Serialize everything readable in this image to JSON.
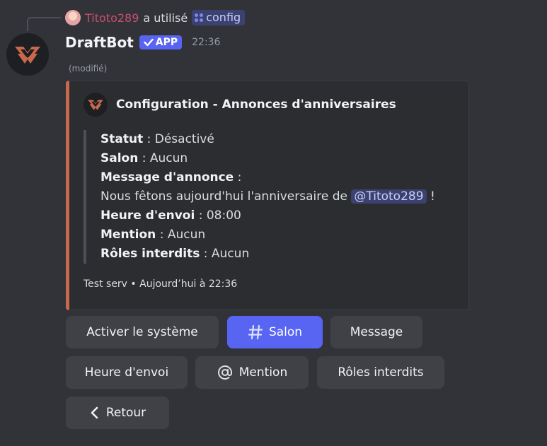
{
  "reply": {
    "username": "Titoto289",
    "action_text": "a utilisé",
    "command": "config"
  },
  "message": {
    "bot_name": "DraftBot",
    "badge": "APP",
    "time": "22:36",
    "edited": "(modifié)"
  },
  "embed": {
    "title": "Configuration - Annonces d'anniversaires",
    "accent_color": "#c8694d",
    "fields": {
      "statut_label": "Statut",
      "statut_value": "Désactivé",
      "salon_label": "Salon",
      "salon_value": "Aucun",
      "message_label": "Message d'annonce",
      "message_text": "Nous fêtons aujourd'hui l'anniversaire de",
      "message_mention": "@Titoto289",
      "message_end": "!",
      "heure_label": "Heure d'envoi",
      "heure_value": "08:00",
      "mention_label": "Mention",
      "mention_value": "Aucun",
      "roles_label": "Rôles interdits",
      "roles_value": "Aucun"
    },
    "footer": "Test serv • Aujourd’hui à 22:36"
  },
  "buttons": {
    "activate": "Activer le système",
    "salon": "Salon",
    "message": "Message",
    "heure": "Heure d'envoi",
    "mention": "Mention",
    "roles": "Rôles interdits",
    "back": "Retour"
  },
  "colors": {
    "primary_button": "#5865f2",
    "secondary_button": "#3f4147",
    "reply_user": "#c94f6d"
  }
}
